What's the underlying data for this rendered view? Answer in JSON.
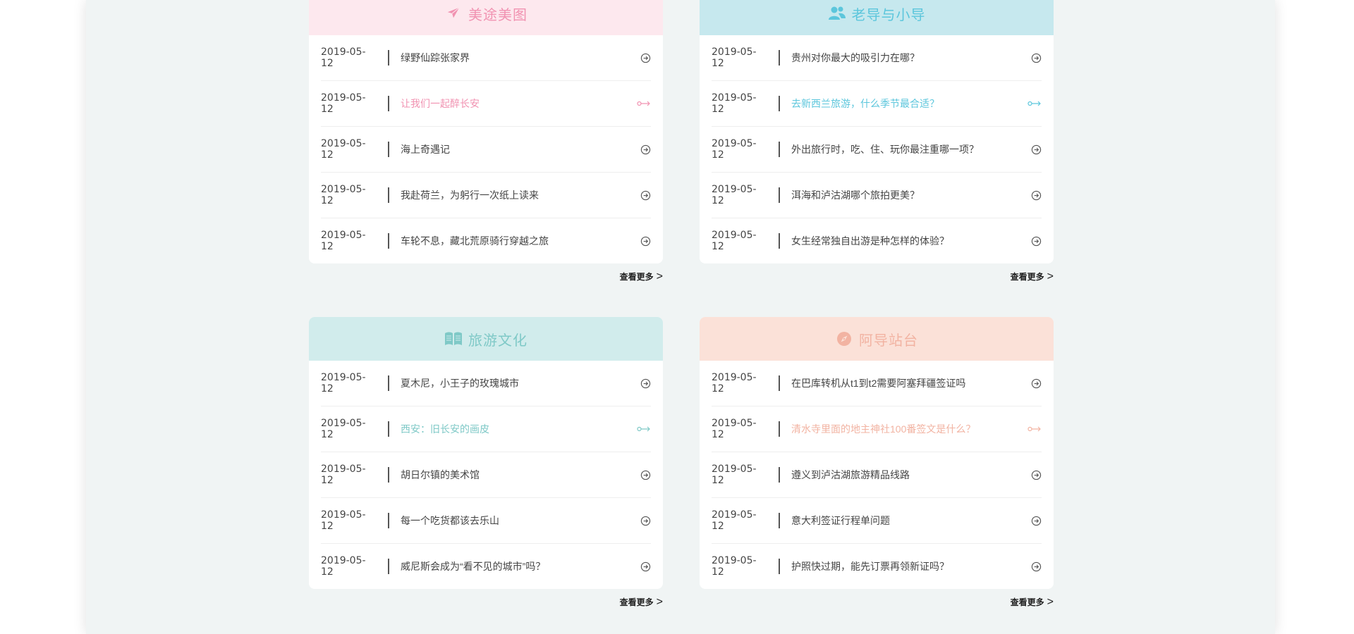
{
  "colors": {
    "pink_head_bg": "#fde8ee",
    "pink_accent": "#f192b1",
    "blue_head_bg": "#c6e8ee",
    "blue_accent": "#5cc6dc",
    "teal_head_bg": "#d1ecec",
    "teal_accent": "#7fc9c7",
    "peach_head_bg": "#fbe1d8",
    "peach_accent": "#f2b3a2"
  },
  "more_label": "查看更多",
  "more_chevron": ">",
  "cards": [
    {
      "title": "美途美图",
      "icon": "airplane-icon",
      "items": [
        {
          "date": "2019-05-12",
          "title": "绿野仙踪张家界",
          "active": false
        },
        {
          "date": "2019-05-12",
          "title": "让我们一起醉长安",
          "active": true
        },
        {
          "date": "2019-05-12",
          "title": "海上奇遇记",
          "active": false
        },
        {
          "date": "2019-05-12",
          "title": "我赴荷兰，为躬行一次纸上读来",
          "active": false
        },
        {
          "date": "2019-05-12",
          "title": "车轮不息，藏北荒原骑行穿越之旅",
          "active": false
        }
      ]
    },
    {
      "title": "老导与小导",
      "icon": "users-icon",
      "items": [
        {
          "date": "2019-05-12",
          "title": "贵州对你最大的吸引力在哪？",
          "active": false
        },
        {
          "date": "2019-05-12",
          "title": "去新西兰旅游，什么季节最合适？",
          "active": true
        },
        {
          "date": "2019-05-12",
          "title": "外出旅行时，吃、住、玩你最注重哪一项？",
          "active": false
        },
        {
          "date": "2019-05-12",
          "title": "洱海和泸沽湖哪个旅拍更美？",
          "active": false
        },
        {
          "date": "2019-05-12",
          "title": " 女生经常独自出游是种怎样的体验？",
          "active": false
        }
      ]
    },
    {
      "title": "旅游文化",
      "icon": "book-icon",
      "items": [
        {
          "date": "2019-05-12",
          "title": "夏木尼，小王子的玫瑰城市",
          "active": false
        },
        {
          "date": "2019-05-12",
          "title": "西安：旧长安的画皮",
          "active": true
        },
        {
          "date": "2019-05-12",
          "title": "胡日尔镇的美术馆",
          "active": false
        },
        {
          "date": "2019-05-12",
          "title": "每一个吃货都该去乐山",
          "active": false
        },
        {
          "date": "2019-05-12",
          "title": "威尼斯会成为“看不见的城市”吗？",
          "active": false
        }
      ]
    },
    {
      "title": "阿导站台",
      "icon": "compass-icon",
      "items": [
        {
          "date": "2019-05-12",
          "title": "在巴库转机从t1到t2需要阿塞拜疆签证吗",
          "active": false
        },
        {
          "date": "2019-05-12",
          "title": "清水寺里面的地主神社100番签文是什么？",
          "active": true
        },
        {
          "date": "2019-05-12",
          "title": "遵义到泸沽湖旅游精品线路",
          "active": false
        },
        {
          "date": "2019-05-12",
          "title": "意大利签证行程单问题",
          "active": false
        },
        {
          "date": "2019-05-12",
          "title": "护照快过期，能先订票再领新证吗？",
          "active": false
        }
      ]
    }
  ]
}
